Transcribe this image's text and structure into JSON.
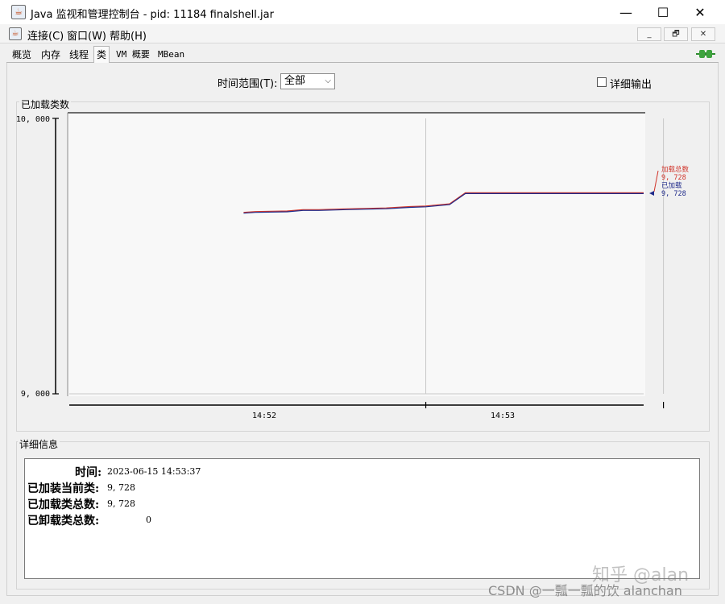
{
  "window": {
    "title": "Java 监视和管理控制台 - pid: 11184 finalshell.jar",
    "minimize": "—",
    "maximize": "☐",
    "close": "✕"
  },
  "menu": {
    "items": [
      "连接(C)",
      "窗口(W)",
      "帮助(H)"
    ],
    "inner_min": "_",
    "inner_restore": "🗗",
    "inner_close": "✕"
  },
  "tabs": [
    {
      "label": "概览",
      "active": false
    },
    {
      "label": "内存",
      "active": false
    },
    {
      "label": "线程",
      "active": false
    },
    {
      "label": "类",
      "active": true
    },
    {
      "label": "VM 概要",
      "active": false
    },
    {
      "label": "MBean",
      "active": false
    }
  ],
  "toolbar": {
    "range_label": "时间范围(T):",
    "range_value": "全部",
    "detail_output_label": "详细输出",
    "detail_output_checked": false
  },
  "chart_group_title": "已加载类数",
  "details_group_title": "详细信息",
  "details": {
    "time_label": "时间:",
    "time_value": "2023-06-15 14:53:37",
    "current_label": "已加装当前类:",
    "current_value": "9, 728",
    "total_label": "已加载类总数:",
    "total_value": "9, 728",
    "unloaded_label": "已卸载类总数:",
    "unloaded_value": "0"
  },
  "chart_data": {
    "type": "line",
    "ylim": [
      9000,
      10000
    ],
    "y_ticks": [
      "10, 000",
      "9, 000"
    ],
    "x_ticks": [
      "14:52",
      "14:53"
    ],
    "x_range_seconds": [
      -90,
      55
    ],
    "x_tick_seconds": [
      0,
      60
    ],
    "series": [
      {
        "name": "加载总数",
        "value_label": "9, 728",
        "color": "#d1352b",
        "points": [
          [
            -46,
            9657
          ],
          [
            -43,
            9660
          ],
          [
            -35,
            9662
          ],
          [
            -31,
            9667
          ],
          [
            -27,
            9667
          ],
          [
            -20,
            9670
          ],
          [
            -10,
            9673
          ],
          [
            -4,
            9678
          ],
          [
            0,
            9680
          ],
          [
            6,
            9688
          ],
          [
            10,
            9728
          ],
          [
            55,
            9728
          ]
        ]
      },
      {
        "name": "已加载",
        "value_label": "9, 728",
        "color": "#1f2a8a",
        "points": [
          [
            -46,
            9657
          ],
          [
            -43,
            9660
          ],
          [
            -35,
            9662
          ],
          [
            -31,
            9667
          ],
          [
            -27,
            9667
          ],
          [
            -20,
            9670
          ],
          [
            -10,
            9673
          ],
          [
            -4,
            9678
          ],
          [
            0,
            9680
          ],
          [
            6,
            9688
          ],
          [
            10,
            9728
          ],
          [
            55,
            9728
          ]
        ]
      }
    ],
    "grid": true
  },
  "watermarks": {
    "csdn": "CSDN @一瓢一瓢的饮 alanchan",
    "zhihu": "知乎 @alan"
  }
}
